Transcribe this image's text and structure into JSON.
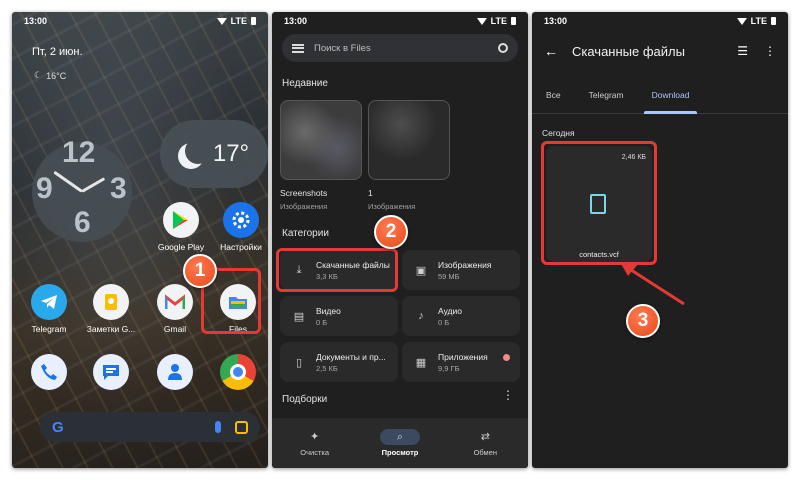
{
  "status": {
    "time": "13:00",
    "network": "LTE"
  },
  "home": {
    "date": "Пт, 2 июн.",
    "weather_small": "16°C",
    "temp_widget": "17°",
    "apps_row1": [
      "Google Play",
      "Настройки"
    ],
    "apps_row2": [
      "Telegram",
      "Заметки G...",
      "Gmail",
      "Files"
    ],
    "search_logo": "G"
  },
  "files": {
    "search_placeholder": "Поиск в Files",
    "recent_title": "Недавние",
    "recent": [
      {
        "name": "Screenshots",
        "type": "Изображения"
      },
      {
        "name": "1",
        "type": "Изображения"
      }
    ],
    "categories_title": "Категории",
    "categories": [
      {
        "title": "Скачанные файлы",
        "size": "3,3 КБ"
      },
      {
        "title": "Изображения",
        "size": "59 МБ"
      },
      {
        "title": "Видео",
        "size": "0 Б"
      },
      {
        "title": "Аудио",
        "size": "0 Б"
      },
      {
        "title": "Документы и пр...",
        "size": "2,5 КБ"
      },
      {
        "title": "Приложения",
        "size": "9,9 ГБ"
      }
    ],
    "collections_title": "Подборки",
    "nav": [
      "Очистка",
      "Просмотр",
      "Обмен"
    ]
  },
  "downloads": {
    "title": "Скачанные файлы",
    "tabs": [
      "Все",
      "Telegram",
      "Download"
    ],
    "active_tab": "Download",
    "section": "Сегодня",
    "file": {
      "name": "contacts.vcf",
      "size": "2,46 КБ"
    }
  },
  "steps": [
    "1",
    "2",
    "3"
  ],
  "colors": {
    "highlight": "#e53935",
    "badge": "#f4511e",
    "accent": "#a8c7fa"
  }
}
